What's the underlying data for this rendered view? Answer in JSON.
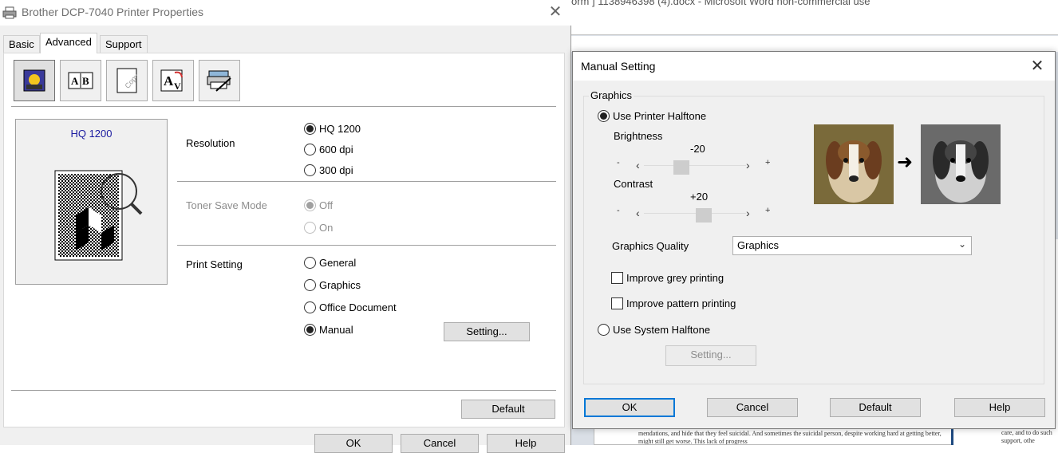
{
  "word": {
    "title": "orm ] 1138946398 (4).docx  -  Microsoft Word non-commercial use",
    "page_left_text": "mendations, and hide that they feel suicidal. And sometimes the suicidal person, despite working hard at getting better, might still get worse. This lack of progress",
    "page_right_text": "care, and to do such support, othe"
  },
  "props": {
    "title": "Brother DCP-7040 Printer Properties",
    "close_glyph": "✕",
    "tabs": [
      {
        "label": "Basic",
        "active": false
      },
      {
        "label": "Advanced",
        "active": true
      },
      {
        "label": "Support",
        "active": false
      }
    ],
    "toolbar_icons": [
      "graphics-icon",
      "watermark-icon",
      "copy-icon",
      "font-icon",
      "device-options-icon"
    ],
    "preview_label": "HQ 1200",
    "resolution": {
      "label": "Resolution",
      "options": [
        "HQ 1200",
        "600 dpi",
        "300 dpi"
      ],
      "selected": "HQ 1200"
    },
    "toner_save": {
      "label": "Toner Save Mode",
      "options": [
        "Off",
        "On"
      ],
      "selected": "Off",
      "disabled": true
    },
    "print_setting": {
      "label": "Print Setting",
      "options": [
        "General",
        "Graphics",
        "Office Document",
        "Manual"
      ],
      "selected": "Manual",
      "setting_button": "Setting..."
    },
    "default_button": "Default",
    "bottom_buttons": [
      "OK",
      "Cancel",
      "Help"
    ]
  },
  "manual": {
    "title": "Manual Setting",
    "close_glyph": "✕",
    "group_label": "Graphics",
    "use_printer_halftone": "Use Printer Halftone",
    "use_printer_halftone_selected": true,
    "brightness": {
      "label": "Brightness",
      "value": "-20",
      "minus": "-",
      "plus": "+",
      "left": "‹",
      "right": "›",
      "level": -20
    },
    "contrast": {
      "label": "Contrast",
      "value": "+20",
      "minus": "-",
      "plus": "+",
      "left": "‹",
      "right": "›",
      "level": 20
    },
    "graphics_quality": {
      "label": "Graphics Quality",
      "value": "Graphics",
      "chevron": "⌄"
    },
    "improve_grey": {
      "label": "Improve grey printing",
      "checked": false
    },
    "improve_pattern": {
      "label": "Improve pattern printing",
      "checked": false
    },
    "use_system_halftone": "Use System Halftone",
    "system_setting_button": "Setting...",
    "buttons": {
      "ok": "OK",
      "cancel": "Cancel",
      "default": "Default",
      "help": "Help"
    },
    "arrow_glyph": "➜"
  }
}
